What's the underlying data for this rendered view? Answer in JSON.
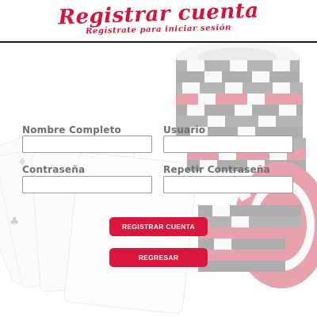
{
  "header": {
    "title": "Registrar cuenta",
    "subtitle": "Regístrate para iniciar sesión"
  },
  "form": {
    "full_name": {
      "label": "Nombre Completo",
      "value": "",
      "placeholder": ""
    },
    "username": {
      "label": "Usuario",
      "value": "",
      "placeholder": ""
    },
    "password": {
      "label": "Contraseña",
      "value": "",
      "placeholder": ""
    },
    "repeat_password": {
      "label": "Repetir Contraseña",
      "value": "",
      "placeholder": ""
    }
  },
  "buttons": {
    "register": "REGISTRAR CUENTA",
    "back": "REGRESAR"
  },
  "background": {
    "image": "poker-chips-and-cards",
    "accent_color": "#d9163c",
    "chip_dark": "#3a3a3a"
  }
}
